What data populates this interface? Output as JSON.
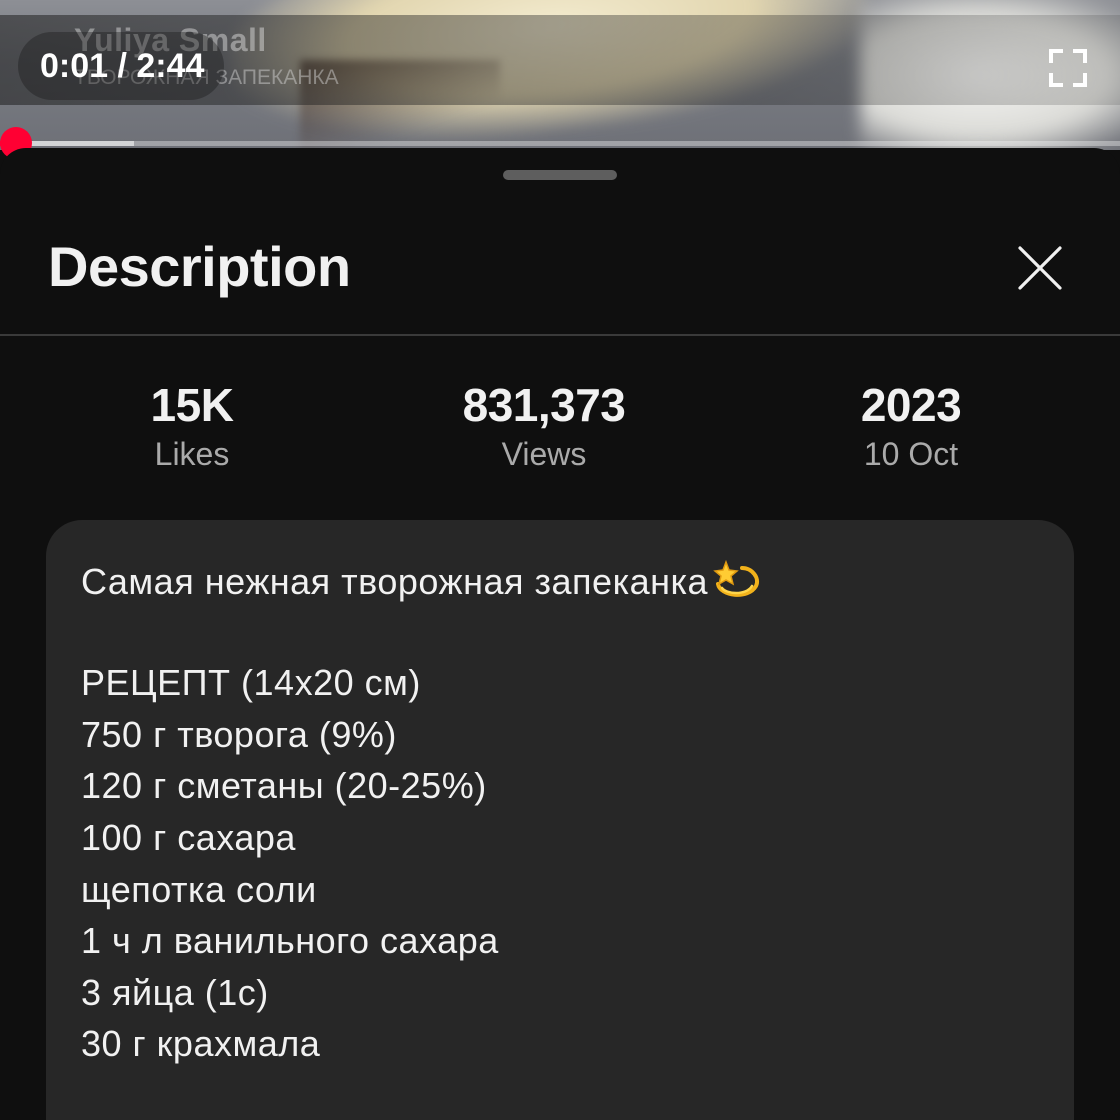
{
  "player": {
    "overlay_title": "Yuliya Small",
    "overlay_subtitle": "ТВОРОЖНАЯ ЗАПЕКАНКА",
    "time_display": "0:01 / 2:44",
    "current_time": "0:01",
    "duration": "2:44",
    "progress_fraction": 0.006,
    "buffered_fraction": 0.12,
    "accent_color": "#ff0033"
  },
  "sheet": {
    "title": "Description",
    "close_icon": "close-icon"
  },
  "stats": {
    "likes": {
      "value": "15K",
      "label": "Likes"
    },
    "views": {
      "value": "831,373",
      "label": "Views"
    },
    "date": {
      "value": "2023",
      "label": "10 Oct"
    }
  },
  "description": {
    "lines": [
      "Самая нежная творожная запеканка",
      "",
      "РЕЦЕПТ (14х20 см)",
      "750 г творога (9%)",
      "120 г сметаны (20-25%)",
      "100 г сахара",
      "щепотка соли",
      "1 ч л ванильного сахара",
      "3 яйца (1с)",
      "30 г крахмала"
    ],
    "title_emoji": "dizzy-star-icon"
  }
}
